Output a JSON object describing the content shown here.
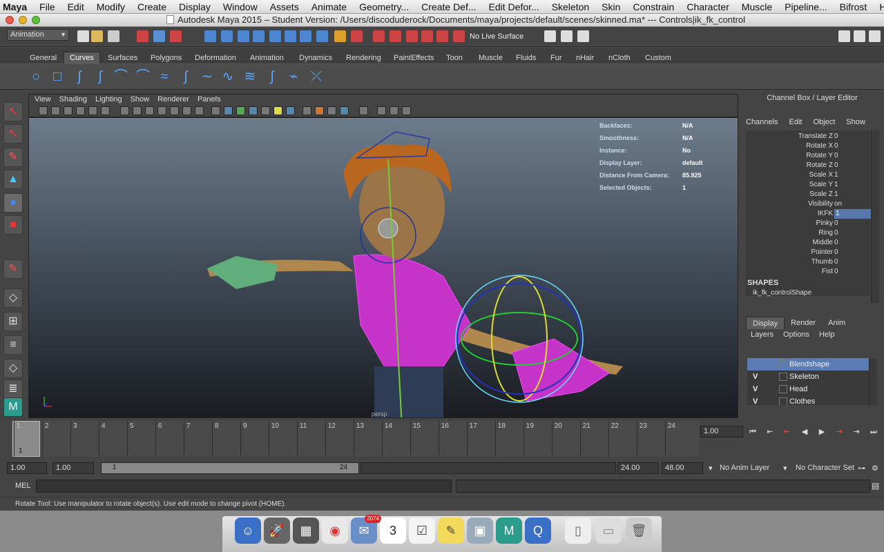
{
  "menubar": {
    "app": "Maya",
    "items": [
      "File",
      "Edit",
      "Modify",
      "Create",
      "Display",
      "Window",
      "Assets",
      "Animate",
      "Geometry...",
      "Create Def...",
      "Edit Defor...",
      "Skeleton",
      "Skin",
      "Constrain",
      "Character",
      "Muscle",
      "Pipeline...",
      "Bifrost",
      "Help"
    ]
  },
  "window": {
    "title": "Autodesk Maya 2015 – Student Version: /Users/discoduderock/Documents/maya/projects/default/scenes/skinned.ma*   ---   Controls|ik_fk_control"
  },
  "statusline": {
    "mode": "Animation",
    "live_surface": "No Live Surface"
  },
  "shelf": {
    "tabs": [
      "General",
      "Curves",
      "Surfaces",
      "Polygons",
      "Deformation",
      "Animation",
      "Dynamics",
      "Rendering",
      "PaintEffects",
      "Toon",
      "Muscle",
      "Fluids",
      "Fur",
      "nHair",
      "nCloth",
      "Custom"
    ],
    "active_tab": "Curves"
  },
  "viewport": {
    "menu": [
      "View",
      "Shading",
      "Lighting",
      "Show",
      "Renderer",
      "Panels"
    ],
    "hud": [
      {
        "label": "Backfaces:",
        "value": "N/A"
      },
      {
        "label": "Smoothness:",
        "value": "N/A"
      },
      {
        "label": "Instance:",
        "value": "No"
      },
      {
        "label": "Display Layer:",
        "value": "default"
      },
      {
        "label": "Distance From Camera:",
        "value": "85.925"
      },
      {
        "label": "Selected Objects:",
        "value": "1"
      }
    ],
    "camera": "persp"
  },
  "channelbox": {
    "title": "Channel Box / Layer Editor",
    "menu": [
      "Channels",
      "Edit",
      "Object",
      "Show"
    ],
    "attributes": [
      {
        "name": "Translate Z",
        "value": "0"
      },
      {
        "name": "Rotate X",
        "value": "0"
      },
      {
        "name": "Rotate Y",
        "value": "0"
      },
      {
        "name": "Rotate Z",
        "value": "0"
      },
      {
        "name": "Scale X",
        "value": "1"
      },
      {
        "name": "Scale Y",
        "value": "1"
      },
      {
        "name": "Scale Z",
        "value": "1"
      },
      {
        "name": "Visibility",
        "value": "on"
      },
      {
        "name": "IKFK",
        "value": "1"
      },
      {
        "name": "Pinky",
        "value": "0"
      },
      {
        "name": "Ring",
        "value": "0"
      },
      {
        "name": "Middle",
        "value": "0"
      },
      {
        "name": "Pointer",
        "value": "0"
      },
      {
        "name": "Thumb",
        "value": "0"
      },
      {
        "name": "Fist",
        "value": "0"
      }
    ],
    "shapes_header": "SHAPES",
    "shape_name": "ik_fk_controlShape"
  },
  "layereditor": {
    "tabs": [
      "Display",
      "Render",
      "Anim"
    ],
    "menu": [
      "Layers",
      "Options",
      "Help"
    ],
    "layers": [
      {
        "v": "",
        "name": "Blendshape"
      },
      {
        "v": "V",
        "name": "Skeleton"
      },
      {
        "v": "V",
        "name": "Head"
      },
      {
        "v": "V",
        "name": "Clothes"
      }
    ]
  },
  "timeline": {
    "ticks": [
      "1",
      "2",
      "3",
      "4",
      "5",
      "6",
      "7",
      "8",
      "9",
      "10",
      "11",
      "12",
      "13",
      "14",
      "15",
      "16",
      "17",
      "18",
      "19",
      "20",
      "21",
      "22",
      "23",
      "24"
    ],
    "current_frame": "1",
    "current_frame_field": "1.00"
  },
  "range": {
    "start": "1.00",
    "anim_start": "1.00",
    "slider_start": "1",
    "slider_end": "24",
    "anim_end": "24.00",
    "end": "48.00",
    "anim_layer": "No Anim Layer",
    "character_set": "No Character Set"
  },
  "cmdline": {
    "label": "MEL"
  },
  "helpline": {
    "text": "Rotate Tool: Use manipulator to rotate object(s). Use edit mode to change pivot (HOME)."
  },
  "dock": {
    "mail_badge": "2074",
    "calendar_day": "3"
  }
}
